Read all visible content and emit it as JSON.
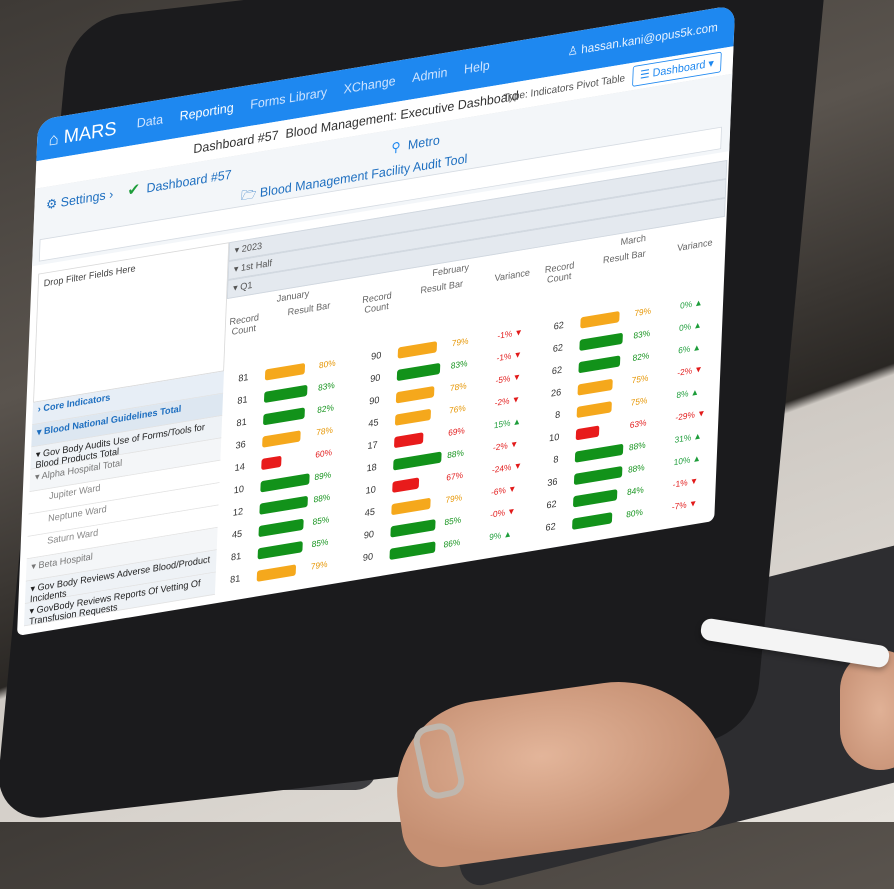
{
  "app": {
    "brand": "MARS",
    "nav": [
      "Data",
      "Reporting",
      "Forms Library",
      "XChange",
      "Admin",
      "Help"
    ],
    "active_nav": "Reporting",
    "user": "hassan.kani@opus5k.com"
  },
  "subbar": {
    "dashboard_number": "Dashboard #57",
    "dashboard_name": "Blood Management: Executive Dashboard",
    "type_label": "Type: Indicators Pivot Table",
    "dashboard_button": "Dashboard"
  },
  "context": {
    "settings": "Settings",
    "dashboard_link": "Dashboard #57",
    "tool": "Blood Management Facility Audit Tool",
    "location": "Metro"
  },
  "pivot": {
    "drop_placeholder": "Drop Filter Fields Here",
    "year": "2023",
    "half": "1st Half",
    "quarter": "Q1",
    "months": [
      "January",
      "February",
      "March"
    ],
    "col_record": "Record Count",
    "col_result": "Result Bar",
    "col_variance": "Variance",
    "rows": [
      {
        "label": "Core Indicators",
        "kind": "core",
        "jan": [
          81,
          "o",
          "80%"
        ],
        "feb": [
          90,
          "o",
          "79%",
          "-1%",
          "down"
        ],
        "mar": [
          62,
          "o",
          "79%",
          "0%",
          "up"
        ]
      },
      {
        "label": "Blood National Guidelines Total",
        "kind": "nat",
        "jan": [
          81,
          "g",
          "83%"
        ],
        "feb": [
          90,
          "g",
          "83%",
          "-1%",
          "down"
        ],
        "mar": [
          62,
          "g",
          "83%",
          "0%",
          "up"
        ]
      },
      {
        "label": "Gov Body Audits Use of Forms/Tools for Blood Products Total",
        "kind": "gov",
        "jan": [
          81,
          "g",
          "82%"
        ],
        "feb": [
          90,
          "o",
          "78%",
          "-5%",
          "down"
        ],
        "mar": [
          62,
          "g",
          "82%",
          "6%",
          "up"
        ]
      },
      {
        "label": "Alpha Hospital Total",
        "kind": "hosp",
        "jan": [
          36,
          "o",
          "78%"
        ],
        "feb": [
          45,
          "o",
          "76%",
          "-2%",
          "down"
        ],
        "mar": [
          26,
          "o",
          "75%",
          "-2%",
          "down"
        ]
      },
      {
        "label": "Jupiter Ward",
        "kind": "ward",
        "jan": [
          14,
          "r",
          "60%"
        ],
        "feb": [
          17,
          "r",
          "69%",
          "15%",
          "up"
        ],
        "mar": [
          8,
          "o",
          "75%",
          "8%",
          "up"
        ]
      },
      {
        "label": "Neptune Ward",
        "kind": "ward",
        "jan": [
          10,
          "g",
          "89%"
        ],
        "feb": [
          18,
          "g",
          "88%",
          "-2%",
          "down"
        ],
        "mar": [
          10,
          "r",
          "63%",
          "-29%",
          "down"
        ]
      },
      {
        "label": "Saturn Ward",
        "kind": "ward",
        "jan": [
          12,
          "g",
          "88%"
        ],
        "feb": [
          10,
          "r",
          "67%",
          "-24%",
          "down"
        ],
        "mar": [
          8,
          "g",
          "88%",
          "31%",
          "up"
        ]
      },
      {
        "label": "Beta Hospital",
        "kind": "hosp",
        "jan": [
          45,
          "g",
          "85%"
        ],
        "feb": [
          45,
          "o",
          "79%",
          "-6%",
          "down"
        ],
        "mar": [
          36,
          "g",
          "88%",
          "10%",
          "up"
        ]
      },
      {
        "label": "Gov Body Reviews Adverse Blood/Product Incidents",
        "kind": "gov",
        "jan": [
          81,
          "g",
          "85%"
        ],
        "feb": [
          90,
          "g",
          "85%",
          "-0%",
          "down"
        ],
        "mar": [
          62,
          "g",
          "84%",
          "-1%",
          "down"
        ]
      },
      {
        "label": "GovBody Reviews Reports Of Vetting Of Transfusion Requests",
        "kind": "gov",
        "jan": [
          81,
          "o",
          "79%"
        ],
        "feb": [
          90,
          "g",
          "86%",
          "9%",
          "up"
        ],
        "mar": [
          62,
          "g",
          "80%",
          "-7%",
          "down"
        ]
      }
    ]
  }
}
